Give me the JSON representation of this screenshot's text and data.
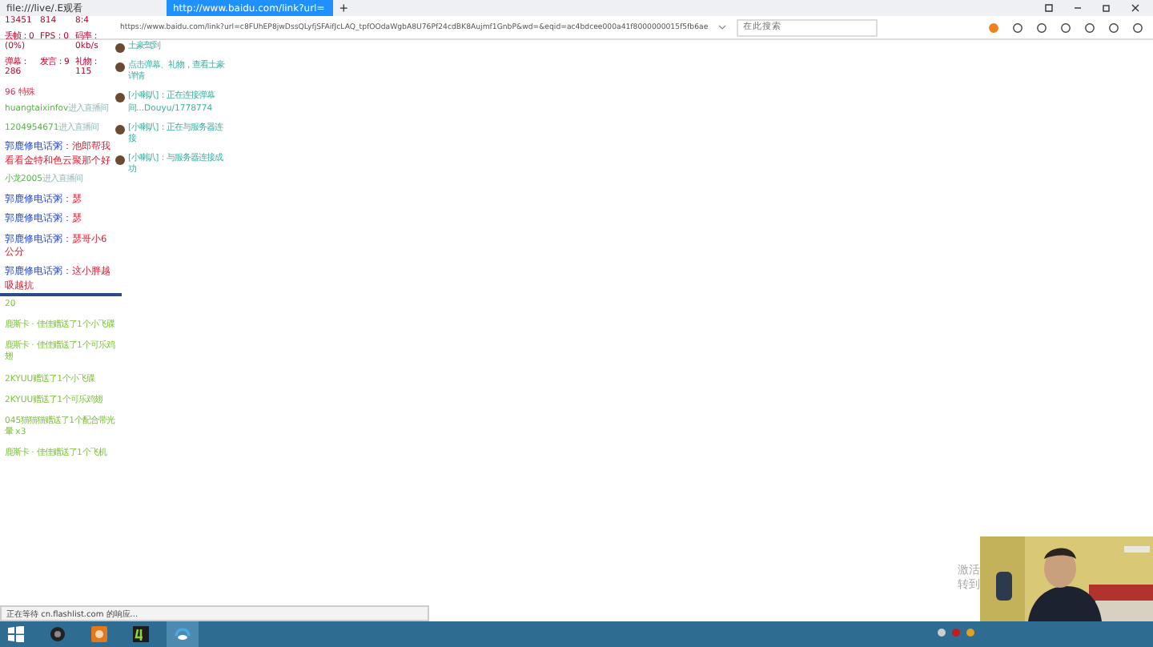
{
  "browser": {
    "tabs": [
      {
        "title": "file:///live/.E观看",
        "selected": false
      },
      {
        "title": "http://www.baidu.com/link?url=",
        "selected": true
      }
    ],
    "new_tab": "+",
    "address": "https://www.baidu.com/link?url=c8FUhEP8jwDssQLyfjSFAifJcLAQ_tpfOOdaWgbA8U76Pf24cdBK8Aujmf1GnbP&wd=&eqid=ac4bdcee000a41f8000000015f5fb6ae",
    "search_placeholder": "在此搜索",
    "status": "正在等待 cn.flashlist.com 的响应..."
  },
  "stats": {
    "rows": [
      [
        "13451",
        "814",
        "8:4"
      ],
      [
        "丢帧：0 (0%)",
        "FPS：0",
        "码率：0kb/s"
      ],
      [
        "弹幕：286",
        "发言：9",
        "礼物：115"
      ]
    ],
    "header": "96 特殊"
  },
  "chat": [
    {
      "kind": "enter",
      "name": "huangtaixinfov",
      "text": "进入直播间"
    },
    {
      "kind": "enter",
      "name": "1204954671",
      "text": "进入直播间"
    },
    {
      "kind": "message",
      "name": "郭鹿修电话粥",
      "text": "：池郎帮我看看金特和色云聚那个好"
    },
    {
      "kind": "enter",
      "name": "小龙2005",
      "text": "进入直播间"
    },
    {
      "kind": "message",
      "name": "郭鹿修电话粥",
      "text": "：瑟"
    },
    {
      "kind": "message",
      "name": "郭鹿修电话粥",
      "text": "：瑟"
    },
    {
      "kind": "message",
      "name": "郭鹿修电话粥",
      "text": "：瑟哥小6公分"
    },
    {
      "kind": "message",
      "name": "郭鹿修电话粥",
      "text": "：这小胖越吸越抗"
    }
  ],
  "notices": [
    "土豪驾到",
    "点击弹幕、礼物，查看土豪详情",
    "[小喇叭]：正在连接弹幕间...Douyu/1778774",
    "[小喇叭]：正在与服务器连接",
    "[小喇叭]：与服务器连接成功"
  ],
  "gifts": {
    "header": "20",
    "items": [
      "鹿斯卡 · 佳佳赠送了1个小飞碟",
      "鹿斯卡 · 佳佳赠送了1个可乐鸡翅",
      "2KYUU赠送了1个小飞碟",
      "2KYUU赠送了1个可乐鸡翅",
      "045猫猫猫赠送了1个配合带光暈 x3",
      "鹿斯卡 · 佳佳赠送了1个飞机"
    ]
  },
  "desktop": {
    "activation": [
      "激活",
      "转到"
    ]
  },
  "webcam": {
    "kind": "picture"
  }
}
